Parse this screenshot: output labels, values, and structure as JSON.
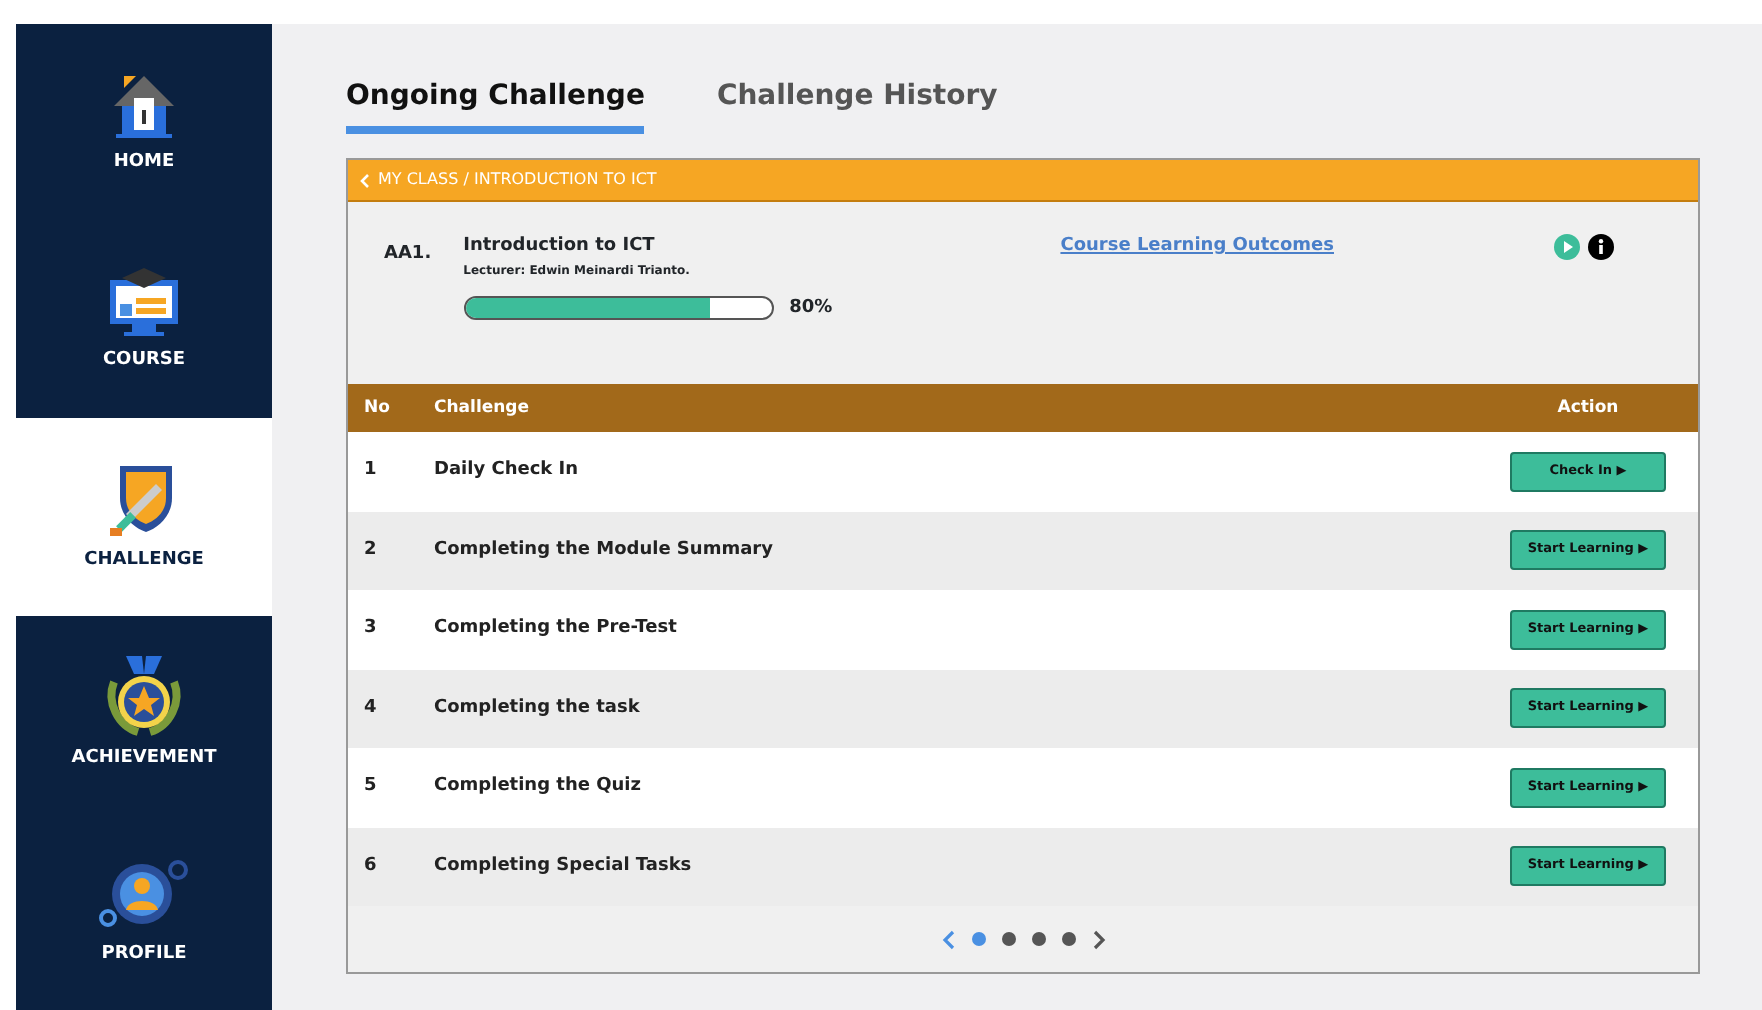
{
  "sidebar": {
    "items": [
      {
        "label": "HOME",
        "kind": "home",
        "selected": false
      },
      {
        "label": "COURSE",
        "kind": "course",
        "selected": false
      },
      {
        "label": "CHALLENGE",
        "kind": "challenge",
        "selected": true
      },
      {
        "label": "ACHIEVEMENT",
        "kind": "achievement",
        "selected": false
      },
      {
        "label": "PROFILE",
        "kind": "profile",
        "selected": false
      }
    ]
  },
  "tabs": [
    {
      "label": "Ongoing Challenge",
      "selected": true
    },
    {
      "label": "Challenge History",
      "selected": false
    }
  ],
  "breadcrumb": "MY CLASS / INTRODUCTION TO ICT",
  "course": {
    "code": "AA1.",
    "title": "Introduction to ICT",
    "lecturer": "Lecturer: Edwin Meinardi Trianto.",
    "level": 0.8,
    "reading": "80%",
    "link": "Course Learning Outcomes"
  },
  "table": {
    "columns": [
      "No",
      "Challenge",
      "Action"
    ],
    "rows": [
      {
        "no": "1",
        "challenge": "Daily Check In",
        "action": "Check In ▶"
      },
      {
        "no": "2",
        "challenge": "Completing the Module Summary",
        "action": "Start Learning ▶"
      },
      {
        "no": "3",
        "challenge": "Completing the Pre-Test",
        "action": "Start Learning ▶"
      },
      {
        "no": "4",
        "challenge": "Completing the task",
        "action": "Start Learning ▶"
      },
      {
        "no": "5",
        "challenge": "Completing the Quiz",
        "action": "Start Learning ▶"
      },
      {
        "no": "6",
        "challenge": "Completing Special Tasks",
        "action": "Start Learning ▶"
      }
    ]
  },
  "pagination": {
    "pages": [
      {
        "selected": true
      },
      {
        "selected": false
      },
      {
        "selected": false
      },
      {
        "selected": false
      }
    ]
  }
}
